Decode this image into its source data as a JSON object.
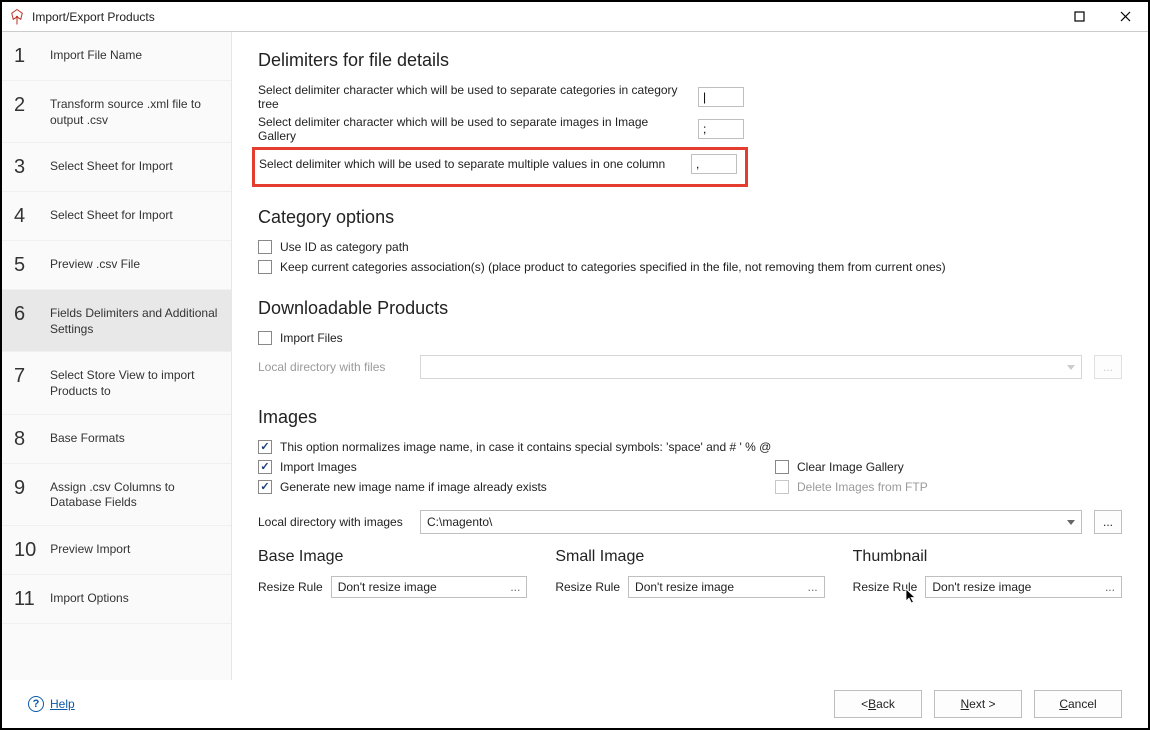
{
  "window": {
    "title": "Import/Export Products"
  },
  "steps": [
    {
      "num": "1",
      "label": "Import File Name"
    },
    {
      "num": "2",
      "label": "Transform source .xml file to output .csv"
    },
    {
      "num": "3",
      "label": "Select Sheet for Import"
    },
    {
      "num": "4",
      "label": "Select Sheet for Import"
    },
    {
      "num": "5",
      "label": "Preview .csv File"
    },
    {
      "num": "6",
      "label": "Fields Delimiters and Additional Settings"
    },
    {
      "num": "7",
      "label": "Select Store View to import Products to"
    },
    {
      "num": "8",
      "label": "Base Formats"
    },
    {
      "num": "9",
      "label": "Assign .csv Columns to Database Fields"
    },
    {
      "num": "10",
      "label": "Preview Import"
    },
    {
      "num": "11",
      "label": "Import Options"
    }
  ],
  "sections": {
    "delimiters_title": "Delimiters for file details",
    "delim_cat_label": "Select delimiter character which will be used to separate categories in category tree",
    "delim_cat_value": "|",
    "delim_img_label": "Select delimiter character which will be used to separate images in Image Gallery",
    "delim_img_value": ";",
    "delim_multi_label": "Select delimiter which will be used to separate multiple values in one column",
    "delim_multi_value": ",",
    "category_title": "Category options",
    "cat_useid": "Use ID as category path",
    "cat_keep": "Keep current categories association(s) (place product to categories specified in the file, not removing them from current ones)",
    "download_title": "Downloadable Products",
    "download_import_files": "Import Files",
    "download_local_dir_label": "Local directory with files",
    "download_local_dir_value": "",
    "images_title": "Images",
    "img_normalize": "This option normalizes image name, in case it contains special symbols: 'space' and # ' % @",
    "img_import": "Import Images",
    "img_clear_gallery": "Clear Image Gallery",
    "img_gen_name": "Generate new image name if image already exists",
    "img_delete_ftp": "Delete Images from FTP",
    "img_local_dir_label": "Local directory with images",
    "img_local_dir_value": "C:\\magento\\",
    "base_image_title": "Base Image",
    "small_image_title": "Small Image",
    "thumbnail_title": "Thumbnail",
    "resize_rule_label": "Resize Rule",
    "resize_rule_value": "Don't resize image"
  },
  "footer": {
    "help": "Help",
    "back": "Back",
    "next": "Next >",
    "cancel": "Cancel"
  }
}
